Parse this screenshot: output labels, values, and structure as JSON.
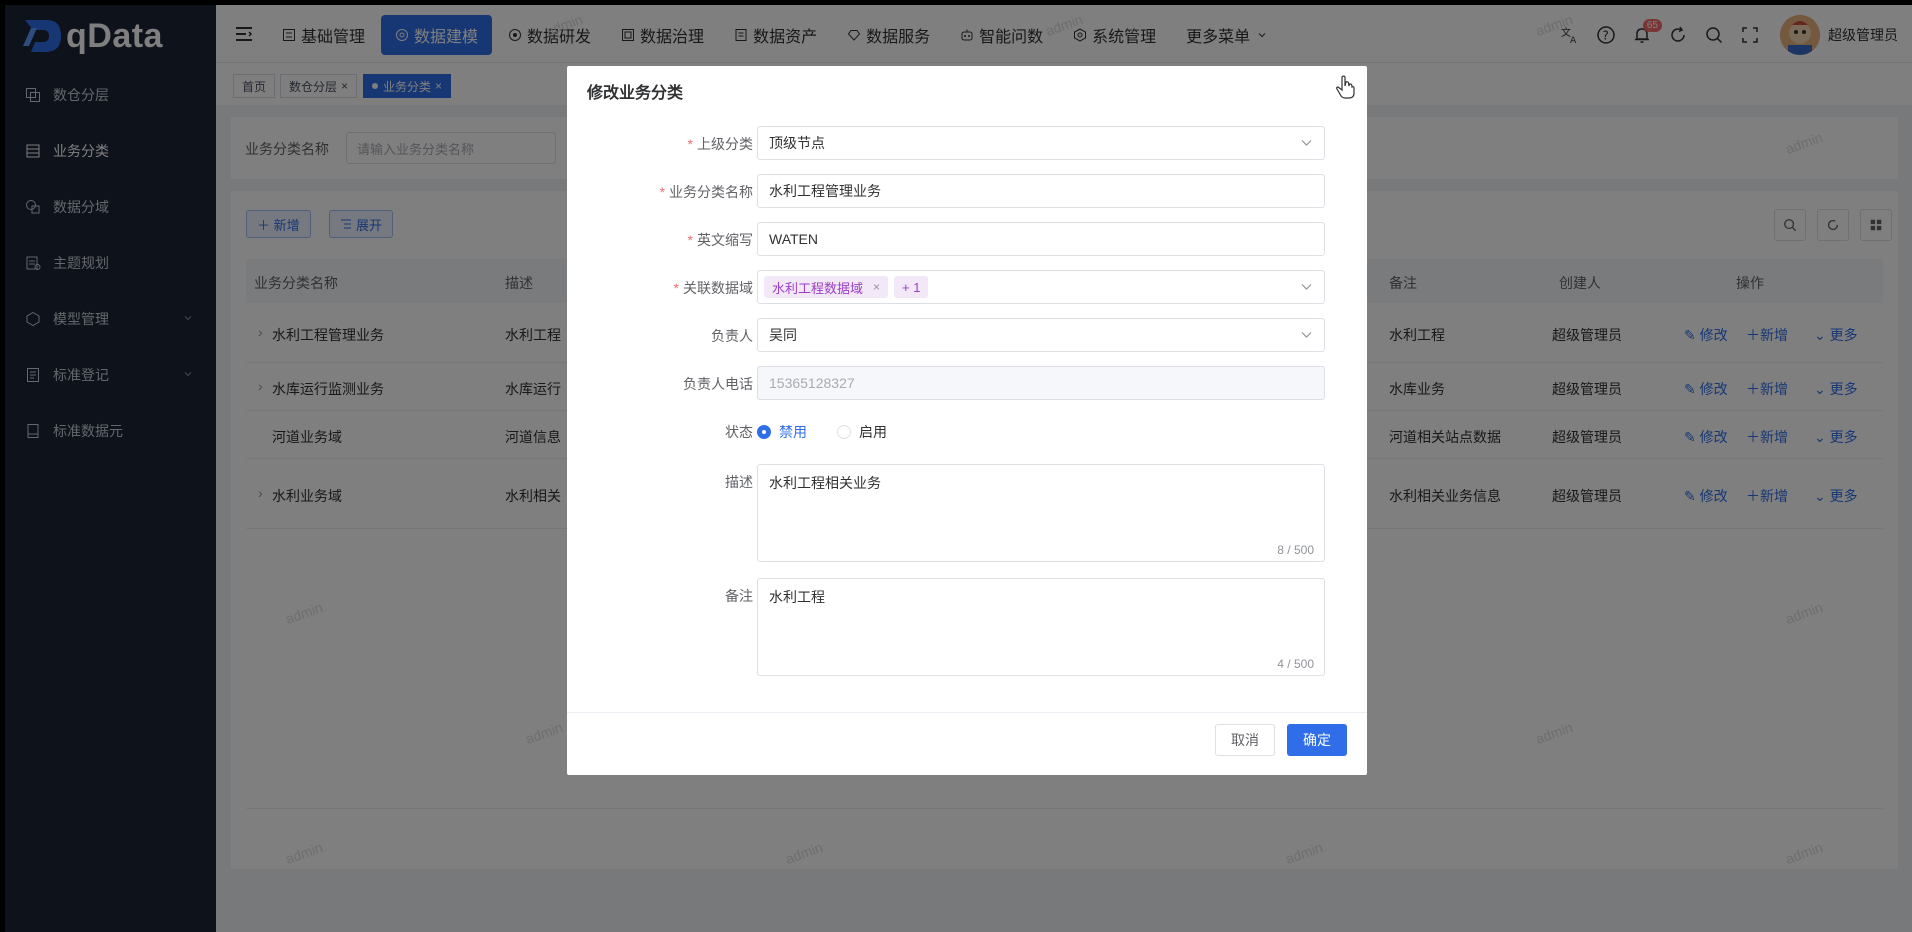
{
  "app": {
    "logo_text": "qData"
  },
  "sidebar": {
    "items": [
      {
        "label": "数仓分层",
        "icon": "layers-icon"
      },
      {
        "label": "业务分类",
        "icon": "category-icon"
      },
      {
        "label": "数据分域",
        "icon": "domain-icon"
      },
      {
        "label": "主题规划",
        "icon": "theme-icon"
      },
      {
        "label": "模型管理",
        "icon": "model-icon"
      },
      {
        "label": "标准登记",
        "icon": "register-icon"
      },
      {
        "label": "标准数据元",
        "icon": "element-icon"
      }
    ]
  },
  "topnav": {
    "items": [
      {
        "label": "基础管理"
      },
      {
        "label": "数据建模"
      },
      {
        "label": "数据研发"
      },
      {
        "label": "数据治理"
      },
      {
        "label": "数据资产"
      },
      {
        "label": "数据服务"
      },
      {
        "label": "智能问数"
      },
      {
        "label": "系统管理"
      },
      {
        "label": "更多菜单"
      }
    ],
    "badge_count": "65",
    "username": "超级管理员"
  },
  "tags": {
    "home": "首页",
    "layer": "数仓分层",
    "current": "业务分类"
  },
  "search": {
    "label": "业务分类名称",
    "placeholder": "请输入业务分类名称"
  },
  "toolbar": {
    "add_label": "新增",
    "expand_label": "展开"
  },
  "table": {
    "headers": {
      "name": "业务分类名称",
      "desc": "描述",
      "remark": "备注",
      "creator": "创建人",
      "ops": "操作"
    },
    "rows": [
      {
        "name": "水利工程管理业务",
        "desc": "水利工程",
        "remark": "水利工程",
        "creator": "超级管理员"
      },
      {
        "name": "水库运行监测业务",
        "desc": "水库运行",
        "remark": "水库业务",
        "creator": "超级管理员"
      },
      {
        "name": "河道业务域",
        "desc": "河道信息",
        "remark": "河道相关站点数据",
        "creator": "超级管理员"
      },
      {
        "name": "水利业务域",
        "desc": "水利相关",
        "remark": "水利相关业务信息",
        "creator": "超级管理员"
      }
    ],
    "op_edit": "修改",
    "op_add": "新增",
    "op_more": "更多"
  },
  "watermark": "admin",
  "dialog": {
    "title": "修改业务分类",
    "fields": {
      "parent_label": "上级分类",
      "parent_value": "顶级节点",
      "name_label": "业务分类名称",
      "name_value": "水利工程管理业务",
      "abbr_label": "英文缩写",
      "abbr_value": "WATEN",
      "domain_label": "关联数据域",
      "domain_chip": "水利工程数据域",
      "domain_more": "+ 1",
      "owner_label": "负责人",
      "owner_value": "吴同",
      "phone_label": "负责人电话",
      "phone_value": "15365128327",
      "status_label": "状态",
      "status_disabled": "禁用",
      "status_enabled": "启用",
      "desc_label": "描述",
      "desc_value": "水利工程相关业务",
      "desc_count": "8 / 500",
      "remark_label": "备注",
      "remark_value": "水利工程",
      "remark_count": "4 / 500"
    },
    "cancel_label": "取消",
    "ok_label": "确定"
  },
  "colors": {
    "primary": "#2f6ee8",
    "sidebar_bg": "#1b2536",
    "required": "#f56c6c",
    "chip_text": "#9b3fc4"
  }
}
